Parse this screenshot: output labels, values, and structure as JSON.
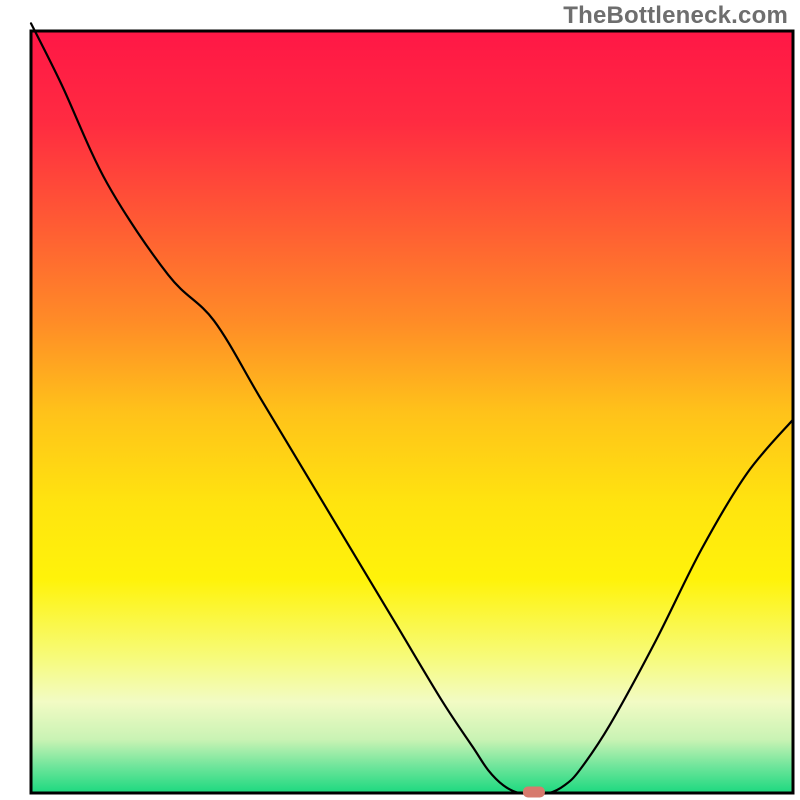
{
  "watermark": "TheBottleneck.com",
  "chart_data": {
    "type": "line",
    "title": "",
    "xlabel": "",
    "ylabel": "",
    "xlim": [
      0,
      100
    ],
    "ylim": [
      0,
      100
    ],
    "grid": false,
    "legend": false,
    "marker": {
      "x": 66,
      "y": 0,
      "color": "#d77a6d",
      "shape": "rounded-rect"
    },
    "gradient_background": {
      "stops": [
        {
          "offset": 0.0,
          "color": "#ff1746"
        },
        {
          "offset": 0.12,
          "color": "#ff2b41"
        },
        {
          "offset": 0.25,
          "color": "#ff5a34"
        },
        {
          "offset": 0.38,
          "color": "#ff8b27"
        },
        {
          "offset": 0.5,
          "color": "#ffc21a"
        },
        {
          "offset": 0.62,
          "color": "#ffe40f"
        },
        {
          "offset": 0.72,
          "color": "#fff30a"
        },
        {
          "offset": 0.82,
          "color": "#f7fb78"
        },
        {
          "offset": 0.88,
          "color": "#f2fbc4"
        },
        {
          "offset": 0.93,
          "color": "#c9f3b4"
        },
        {
          "offset": 0.965,
          "color": "#6fe59b"
        },
        {
          "offset": 1.0,
          "color": "#1cd97f"
        }
      ]
    },
    "x": [
      0,
      4,
      10,
      18,
      24,
      30,
      36,
      42,
      48,
      54,
      58,
      60,
      62,
      64,
      66,
      68,
      70,
      72,
      76,
      82,
      88,
      94,
      100
    ],
    "values": [
      101,
      93,
      80,
      68,
      62,
      52,
      42,
      32,
      22,
      12,
      6,
      3,
      1,
      0,
      0,
      0,
      1,
      3,
      9,
      20,
      32,
      42,
      49
    ],
    "frame_color": "#000000",
    "line_color": "#000000",
    "line_width": 2.2
  }
}
